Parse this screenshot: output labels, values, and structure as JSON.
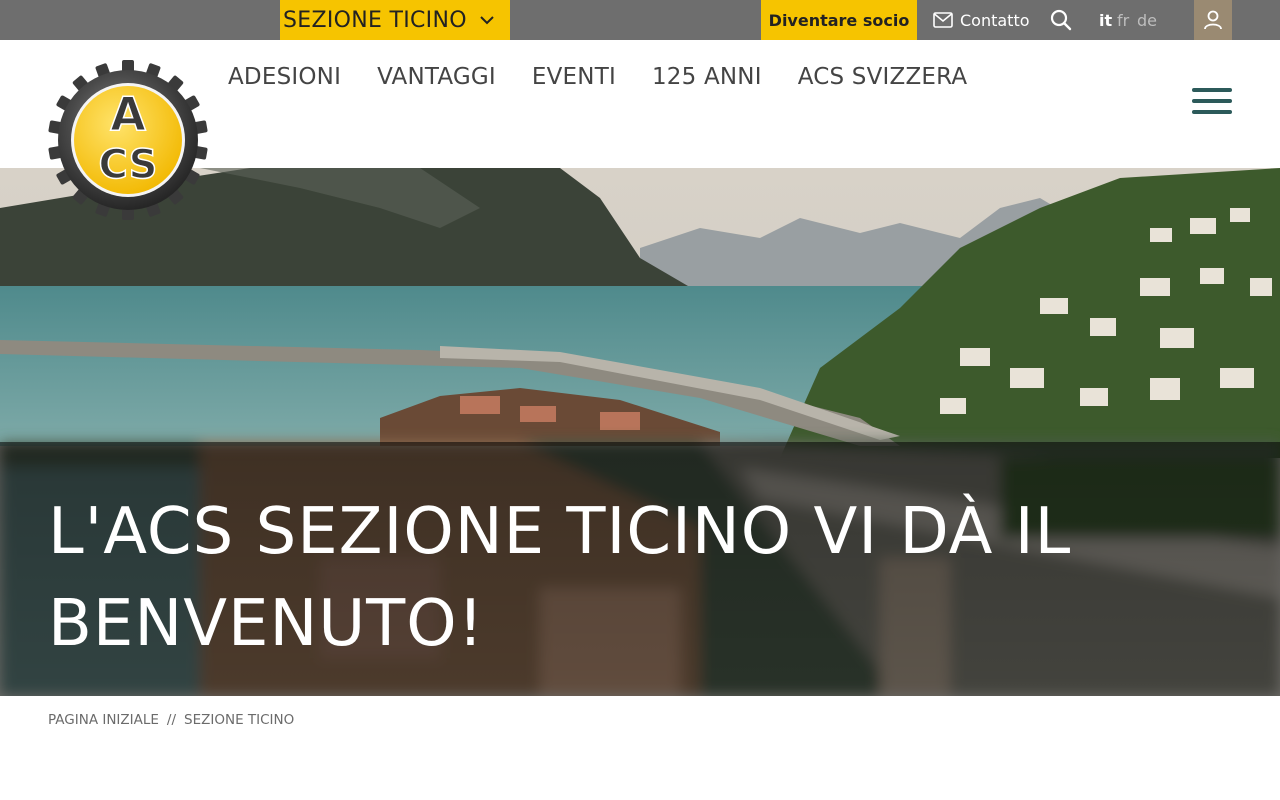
{
  "topbar": {
    "section_select": "SEZIONE TICINO",
    "become_member": "Diventare socio",
    "contact": "Contatto",
    "languages": [
      "it",
      "fr",
      "de"
    ],
    "active_language": "it"
  },
  "nav": {
    "items": [
      "ADESIONI",
      "VANTAGGI",
      "EVENTI",
      "125 ANNI",
      "ACS SVIZZERA"
    ]
  },
  "logo": {
    "text": "ACS"
  },
  "hero": {
    "title_line1": "L'ACS SEZIONE TICINO VI DÀ IL",
    "title_line2": "BENVENUTO!"
  },
  "breadcrumb": {
    "home": "PAGINA INIZIALE",
    "separator": "//",
    "current": "SEZIONE TICINO"
  },
  "colors": {
    "brand_yellow": "#f6c400",
    "topbar_gray": "#6e6e6e",
    "hamburger": "#2c5a5a",
    "user_button": "#9a8a72"
  },
  "icons": [
    "chevron-down-icon",
    "mail-icon",
    "search-icon",
    "user-icon",
    "menu-icon"
  ]
}
